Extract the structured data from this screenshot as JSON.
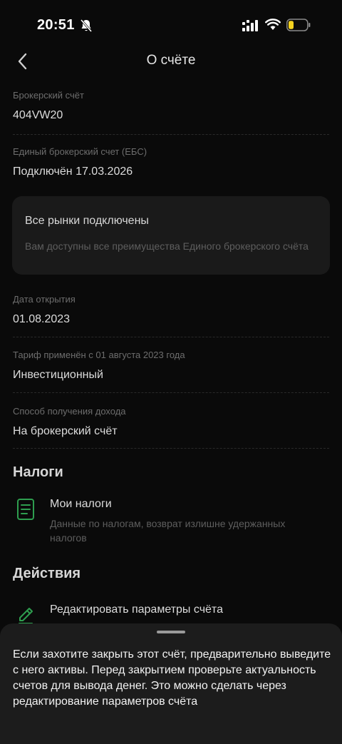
{
  "status_bar": {
    "time": "20:51"
  },
  "nav": {
    "title": "О счёте"
  },
  "fields": [
    {
      "label": "Брокерский счёт",
      "value": "404VW20"
    },
    {
      "label": "Единый брокерский счет (ЕБС)",
      "value": "Подключён 17.03.2026"
    },
    {
      "label": "Дата открытия",
      "value": "01.08.2023"
    },
    {
      "label": "Тариф применён с 01 августа 2023 года",
      "value": "Инвестиционный"
    },
    {
      "label": "Способ получения дохода",
      "value": "На брокерский счёт"
    }
  ],
  "ebs_card": {
    "title": "Все рынки подключены",
    "text": "Вам доступны все преимущества Единого брокерского счёта"
  },
  "taxes": {
    "heading": "Налоги",
    "item": {
      "title": "Мои налоги",
      "subtitle": "Данные по налогам, возврат излишне удержанных налогов",
      "icon": "document-icon"
    }
  },
  "actions": {
    "heading": "Действия",
    "item": {
      "title": "Редактировать параметры счёта",
      "icon": "pencil-icon"
    }
  },
  "sheet": {
    "text": "Если захотите закрыть этот счёт, предварительно выведите с него активы. Перед закрытием проверьте актуальность счетов для вывода денег. Это можно сделать через редактирование параметров счёта"
  },
  "colors": {
    "accent_green": "#2e9e4f",
    "battery_level": "#f4d21f",
    "background": "#0a0a0a",
    "sheet": "#1c1c1c"
  }
}
